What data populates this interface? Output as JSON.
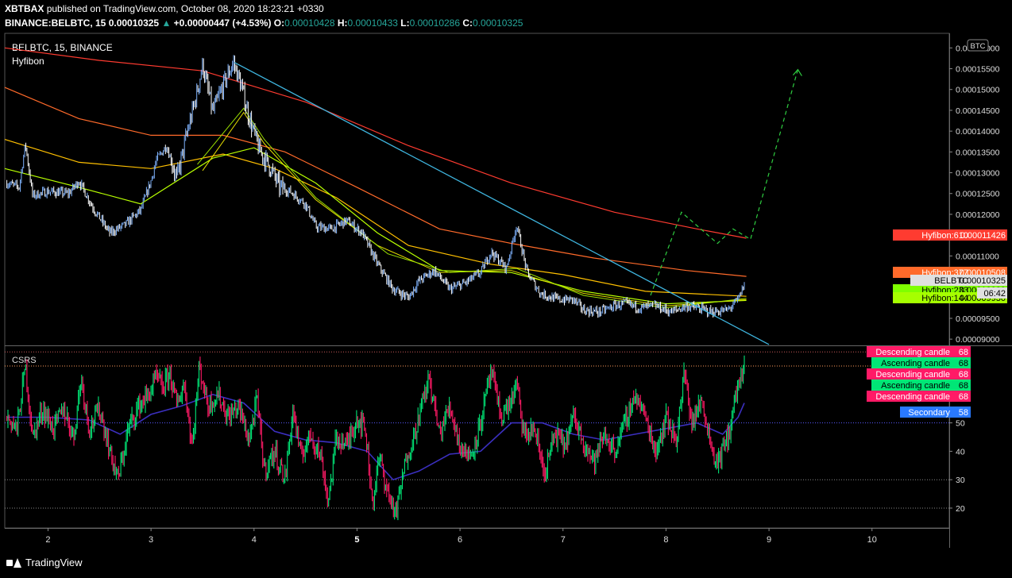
{
  "header": {
    "author": "XBTBAX",
    "published_text": "published on TradingView.com, October 08, 2020 18:23:21 +0330",
    "symbol": "BINANCE:BELBTC, 15",
    "price": "0.00010325",
    "change": "+0.00000447 (+4.53%)",
    "o_label": "O:",
    "o_value": "0.00010428",
    "h_label": "H:",
    "h_value": "0.00010433",
    "l_label": "L:",
    "l_value": "0.00010286",
    "c_label": "C:",
    "c_value": "0.00010325"
  },
  "footer": {
    "brand": "TradingView"
  },
  "colors": {
    "up": "#7fb3ff",
    "down": "#ffffff",
    "ema610": "#ff3b30",
    "ema377": "#ff6a2a",
    "ema233": "#ffc000",
    "ema144": "#b8ff00",
    "trendline": "#3fb6e0",
    "projection": "#2ecc40",
    "csrs_up": "#00e676",
    "csrs_down": "#ff1a66",
    "secondary": "#3b2fbf"
  },
  "chart_data": [
    {
      "type": "candlestick",
      "title": "BELBTC, 15, BINANCE",
      "indicator_name": "Hyfibon",
      "currency_label": "BTC",
      "x_ticks": [
        "2",
        "3",
        "4",
        "5",
        "6",
        "7",
        "8",
        "9",
        "10"
      ],
      "y_ticks": [
        "0.00009000",
        "0.00009500",
        "0.00010000",
        "0.00010500",
        "0.00011000",
        "0.00011500",
        "0.00012000",
        "0.00012500",
        "0.00013000",
        "0.00013500",
        "0.00014000",
        "0.00014500",
        "0.00015000",
        "0.00015500",
        "0.00016000"
      ],
      "ylim": [
        8.85e-05,
        0.0001635
      ],
      "xlim": [
        1.58,
        10.75
      ],
      "price_path": [
        [
          1.6,
          0.0001275
        ],
        [
          1.72,
          0.0001265
        ],
        [
          1.78,
          0.000137
        ],
        [
          1.85,
          0.0001245
        ],
        [
          2.0,
          0.0001255
        ],
        [
          2.2,
          0.000125
        ],
        [
          2.3,
          0.000128
        ],
        [
          2.45,
          0.000121
        ],
        [
          2.6,
          0.0001155
        ],
        [
          2.75,
          0.0001175
        ],
        [
          2.9,
          0.000121
        ],
        [
          3.0,
          0.000128
        ],
        [
          3.05,
          0.000133
        ],
        [
          3.15,
          0.0001365
        ],
        [
          3.25,
          0.0001285
        ],
        [
          3.35,
          0.0001395
        ],
        [
          3.45,
          0.0001495
        ],
        [
          3.5,
          0.000156
        ],
        [
          3.6,
          0.0001445
        ],
        [
          3.7,
          0.000151
        ],
        [
          3.8,
          0.0001565
        ],
        [
          3.88,
          0.0001505
        ],
        [
          3.95,
          0.0001435
        ],
        [
          4.05,
          0.0001355
        ],
        [
          4.15,
          0.0001315
        ],
        [
          4.25,
          0.0001265
        ],
        [
          4.35,
          0.0001255
        ],
        [
          4.5,
          0.0001225
        ],
        [
          4.6,
          0.000117
        ],
        [
          4.75,
          0.0001165
        ],
        [
          4.9,
          0.0001185
        ],
        [
          5.05,
          0.0001155
        ],
        [
          5.2,
          0.000108
        ],
        [
          5.35,
          0.000102
        ],
        [
          5.5,
          0.0001
        ],
        [
          5.6,
          0.000104
        ],
        [
          5.75,
          0.0001065
        ],
        [
          5.9,
          0.000102
        ],
        [
          6.05,
          0.0001035
        ],
        [
          6.2,
          0.000106
        ],
        [
          6.3,
          0.000111
        ],
        [
          6.45,
          0.000107
        ],
        [
          6.55,
          0.0001175
        ],
        [
          6.65,
          0.000106
        ],
        [
          6.78,
          0.000101
        ],
        [
          6.95,
          9.95e-05
        ],
        [
          7.1,
          9.95e-05
        ],
        [
          7.2,
          9.7e-05
        ],
        [
          7.35,
          9.65e-05
        ],
        [
          7.5,
          9.8e-05
        ],
        [
          7.6,
          9.85e-05
        ],
        [
          7.75,
          9.75e-05
        ],
        [
          7.9,
          9.8e-05
        ],
        [
          8.05,
          9.65e-05
        ],
        [
          8.2,
          9.8e-05
        ],
        [
          8.3,
          9.75e-05
        ],
        [
          8.45,
          9.65e-05
        ],
        [
          8.6,
          9.7e-05
        ],
        [
          8.7,
          9.95e-05
        ],
        [
          8.76,
          0.0001032
        ]
      ],
      "ma_series": [
        {
          "name": "Hyfibon:610",
          "value_label": "0.00011426",
          "value": 0.00011426,
          "points": [
            [
              1.58,
              0.00016
            ],
            [
              2.5,
              0.000157
            ],
            [
              3.5,
              0.0001545
            ],
            [
              4.5,
              0.000147
            ],
            [
              5.5,
              0.0001365
            ],
            [
              6.5,
              0.0001275
            ],
            [
              7.5,
              0.0001205
            ],
            [
              8.3,
              0.0001165
            ],
            [
              8.78,
              0.00011426
            ]
          ]
        },
        {
          "name": "Hyfibon:377",
          "value_label": "0.00010508",
          "value": 0.00010508,
          "points": [
            [
              1.58,
              0.0001505
            ],
            [
              2.3,
              0.000143
            ],
            [
              3.0,
              0.000139
            ],
            [
              3.7,
              0.000139
            ],
            [
              4.3,
              0.000135
            ],
            [
              5.0,
              0.0001265
            ],
            [
              5.8,
              0.0001165
            ],
            [
              6.5,
              0.000113
            ],
            [
              7.3,
              0.0001095
            ],
            [
              8.2,
              0.0001065
            ],
            [
              8.78,
              0.00010508
            ]
          ]
        },
        {
          "name": "Hyfibon:233",
          "value_label": "0.00010029",
          "value": 0.00010029,
          "points": [
            [
              1.58,
              0.000138
            ],
            [
              2.3,
              0.0001325
            ],
            [
              3.0,
              0.000131
            ],
            [
              3.7,
              0.0001345
            ],
            [
              4.2,
              0.000131
            ],
            [
              4.8,
              0.000124
            ],
            [
              5.5,
              0.0001125
            ],
            [
              6.3,
              0.000108
            ],
            [
              7.0,
              0.0001055
            ],
            [
              7.8,
              0.0001015
            ],
            [
              8.78,
              0.0001003
            ]
          ]
        },
        {
          "name": "Hyfibon:144",
          "value_label": "0.00009930",
          "value": 9.93e-05,
          "points": [
            [
              1.58,
              0.000131
            ],
            [
              2.3,
              0.0001265
            ],
            [
              2.9,
              0.0001225
            ],
            [
              3.6,
              0.0001335
            ],
            [
              4.0,
              0.000136
            ],
            [
              4.6,
              0.0001275
            ],
            [
              5.2,
              0.0001155
            ],
            [
              5.8,
              0.0001065
            ],
            [
              6.5,
              0.000106
            ],
            [
              7.2,
              0.0001015
            ],
            [
              8.0,
              9.85e-05
            ],
            [
              8.78,
              9.93e-05
            ]
          ]
        }
      ],
      "extra_ema": [
        {
          "points": [
            [
              3.5,
              0.0001305
            ],
            [
              3.9,
              0.0001445
            ],
            [
              4.1,
              0.000137
            ],
            [
              4.6,
              0.0001235
            ],
            [
              5.2,
              0.0001125
            ],
            [
              5.8,
              0.000106
            ],
            [
              6.5,
              0.0001065
            ],
            [
              7.2,
              0.000101
            ],
            [
              8.0,
              9.8e-05
            ],
            [
              8.78,
              9.95e-05
            ]
          ]
        },
        {
          "points": [
            [
              3.45,
              0.000132
            ],
            [
              3.9,
              0.0001455
            ],
            [
              4.1,
              0.000138
            ],
            [
              4.6,
              0.000124
            ],
            [
              5.3,
              0.0001105
            ],
            [
              5.9,
              0.000106
            ],
            [
              6.55,
              0.000107
            ],
            [
              7.2,
              0.0001005
            ],
            [
              8.0,
              9.75e-05
            ],
            [
              8.78,
              9.98e-05
            ]
          ]
        }
      ],
      "trendline": [
        [
          3.81,
          0.0001565
        ],
        [
          9.0,
          8.87e-05
        ]
      ],
      "projection": [
        [
          7.85,
          0.0001005
        ],
        [
          8.15,
          0.0001205
        ],
        [
          8.5,
          0.000113
        ],
        [
          8.65,
          0.0001165
        ],
        [
          8.82,
          0.000114
        ],
        [
          9.28,
          0.0001548
        ]
      ],
      "last_price_label": "BELBTC",
      "last_price": "0.00010325",
      "countdown": "06:42"
    },
    {
      "type": "line",
      "title": "CSRS",
      "ylim": [
        13,
        77
      ],
      "y_ticks": [
        "20",
        "30",
        "40",
        "50",
        "60"
      ],
      "levels": [
        75,
        70,
        50,
        30,
        20
      ],
      "csrs_path": [
        [
          1.6,
          52
        ],
        [
          1.7,
          48
        ],
        [
          1.78,
          70
        ],
        [
          1.85,
          45
        ],
        [
          1.95,
          55
        ],
        [
          2.05,
          48
        ],
        [
          2.15,
          55
        ],
        [
          2.25,
          45
        ],
        [
          2.32,
          66
        ],
        [
          2.4,
          48
        ],
        [
          2.5,
          55
        ],
        [
          2.6,
          40
        ],
        [
          2.68,
          30
        ],
        [
          2.78,
          48
        ],
        [
          2.88,
          56
        ],
        [
          2.98,
          60
        ],
        [
          3.05,
          66
        ],
        [
          3.12,
          62
        ],
        [
          3.18,
          68
        ],
        [
          3.25,
          56
        ],
        [
          3.32,
          64
        ],
        [
          3.4,
          42
        ],
        [
          3.47,
          70
        ],
        [
          3.55,
          56
        ],
        [
          3.65,
          60
        ],
        [
          3.75,
          52
        ],
        [
          3.85,
          56
        ],
        [
          3.95,
          44
        ],
        [
          4.03,
          58
        ],
        [
          4.1,
          33
        ],
        [
          4.2,
          40
        ],
        [
          4.3,
          30
        ],
        [
          4.38,
          55
        ],
        [
          4.45,
          38
        ],
        [
          4.55,
          46
        ],
        [
          4.65,
          38
        ],
        [
          4.72,
          22
        ],
        [
          4.8,
          45
        ],
        [
          4.9,
          42
        ],
        [
          5.0,
          52
        ],
        [
          5.08,
          48
        ],
        [
          5.15,
          22
        ],
        [
          5.22,
          38
        ],
        [
          5.3,
          25
        ],
        [
          5.38,
          18
        ],
        [
          5.48,
          38
        ],
        [
          5.55,
          45
        ],
        [
          5.62,
          55
        ],
        [
          5.7,
          66
        ],
        [
          5.8,
          46
        ],
        [
          5.9,
          56
        ],
        [
          6.0,
          42
        ],
        [
          6.1,
          38
        ],
        [
          6.2,
          50
        ],
        [
          6.3,
          68
        ],
        [
          6.4,
          52
        ],
        [
          6.5,
          58
        ],
        [
          6.55,
          64
        ],
        [
          6.62,
          45
        ],
        [
          6.72,
          48
        ],
        [
          6.82,
          32
        ],
        [
          6.92,
          46
        ],
        [
          7.02,
          42
        ],
        [
          7.1,
          52
        ],
        [
          7.2,
          44
        ],
        [
          7.3,
          36
        ],
        [
          7.4,
          46
        ],
        [
          7.5,
          40
        ],
        [
          7.6,
          50
        ],
        [
          7.7,
          60
        ],
        [
          7.8,
          52
        ],
        [
          7.9,
          40
        ],
        [
          8.0,
          52
        ],
        [
          8.1,
          44
        ],
        [
          8.18,
          68
        ],
        [
          8.25,
          50
        ],
        [
          8.35,
          58
        ],
        [
          8.45,
          40
        ],
        [
          8.5,
          36
        ],
        [
          8.6,
          45
        ],
        [
          8.68,
          60
        ],
        [
          8.72,
          66
        ],
        [
          8.76,
          68
        ]
      ],
      "secondary_path": [
        [
          1.6,
          52
        ],
        [
          2.0,
          52
        ],
        [
          2.4,
          51
        ],
        [
          2.7,
          46
        ],
        [
          3.0,
          53
        ],
        [
          3.3,
          56
        ],
        [
          3.6,
          60
        ],
        [
          3.9,
          57
        ],
        [
          4.2,
          47
        ],
        [
          4.5,
          44
        ],
        [
          4.8,
          43
        ],
        [
          5.1,
          40
        ],
        [
          5.35,
          30
        ],
        [
          5.6,
          33
        ],
        [
          5.9,
          39
        ],
        [
          6.2,
          40
        ],
        [
          6.5,
          50
        ],
        [
          6.8,
          50
        ],
        [
          7.1,
          46
        ],
        [
          7.4,
          44
        ],
        [
          7.7,
          46
        ],
        [
          8.0,
          48
        ],
        [
          8.3,
          50
        ],
        [
          8.55,
          46
        ],
        [
          8.7,
          52
        ],
        [
          8.76,
          57
        ]
      ],
      "labels": [
        {
          "text": "Descending candle",
          "value": "68",
          "kind": "down"
        },
        {
          "text": "Ascending candle",
          "value": "68",
          "kind": "up"
        },
        {
          "text": "Descending candle",
          "value": "68",
          "kind": "down"
        },
        {
          "text": "Ascending candle",
          "value": "68",
          "kind": "up"
        },
        {
          "text": "Descending candle",
          "value": "68",
          "kind": "down"
        },
        {
          "text": "Secondary",
          "value": "58",
          "kind": "secondary"
        }
      ]
    }
  ]
}
